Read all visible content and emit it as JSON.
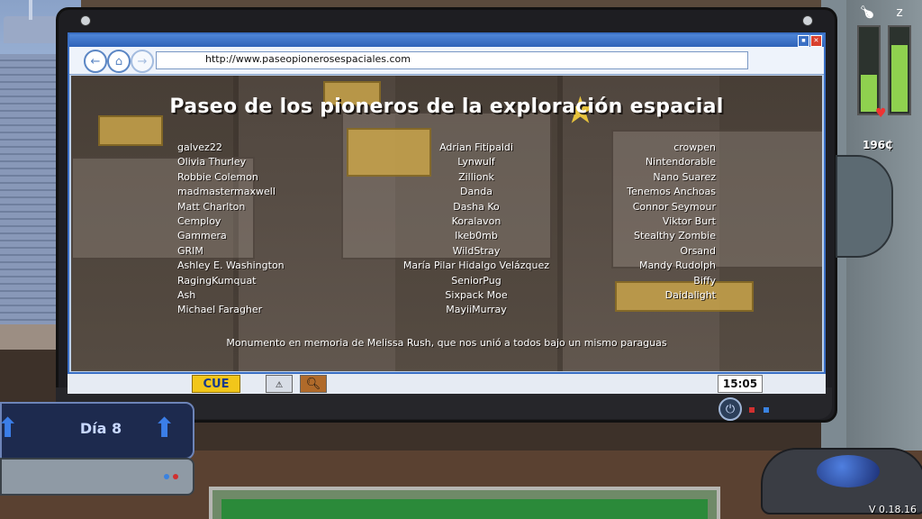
{
  "browser": {
    "url": "http://www.paseopionerosespaciales.com"
  },
  "page": {
    "title": "Paseo de los pioneros de la exploración espacial",
    "names_left": [
      "galvez22",
      "Olivia Thurley",
      "Robbie Colemon",
      "madmastermaxwell",
      "Matt Charlton",
      "Cemploy",
      "Gammera",
      "GRIM",
      "Ashley E. Washington",
      "RagingKumquat",
      "Ash",
      "Michael Faragher"
    ],
    "names_middle": [
      "Adrian Fitipaldi",
      "Lynwulf",
      "Zillionk",
      "Danda",
      "Dasha Ko",
      "Koralavon",
      "Ikeb0mb",
      "WildStray",
      "María Pilar Hidalgo Velázquez",
      "SeniorPug",
      "Sixpack Moe",
      "MayiiMurray"
    ],
    "names_right": [
      "crowpen",
      "Nintendorable",
      "Nano Suarez",
      "Tenemos Anchoas",
      "Connor Seymour",
      "Viktor Burt",
      "Stealthy Zombie",
      "Orsand",
      "Mandy Rudolph",
      "Biffy",
      "Daidalight"
    ],
    "memorial": "Monumento en memoria de Melissa Rush, que nos unió a todos bajo un mismo paraguas"
  },
  "taskbar": {
    "start_label": "CUE",
    "clock": "15:05",
    "icons": [
      "warning-icon",
      "search-icon"
    ]
  },
  "hud": {
    "money": "196₵",
    "version": "V 0.18.16",
    "meter_left_level": 0.45,
    "meter_right_level": 0.8
  },
  "day_panel": {
    "label": "Día 8"
  },
  "colors": {
    "window_accent": "#3a6fc4",
    "start_button": "#f2c61a",
    "meter": "#8fd14f"
  }
}
